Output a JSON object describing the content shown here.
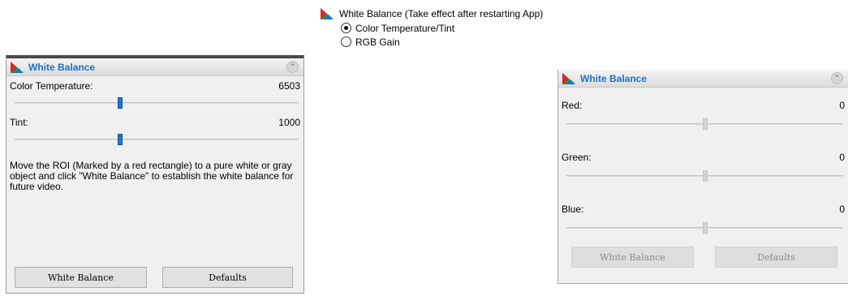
{
  "option_group": {
    "title": "White Balance (Take effect after restarting App)",
    "options": [
      {
        "label": "Color Temperature/Tint",
        "selected": true
      },
      {
        "label": "RGB Gain",
        "selected": false
      }
    ]
  },
  "left_panel": {
    "title": "White Balance",
    "temperature": {
      "label": "Color Temperature:",
      "value": "6503",
      "position": 0.37
    },
    "tint": {
      "label": "Tint:",
      "value": "1000",
      "position": 0.37
    },
    "description": "Move the ROI (Marked by a red rectangle) to a pure white or gray object and click \"White Balance\" to establish the white balance for future video.",
    "buttons": {
      "white_balance": "White Balance",
      "defaults": "Defaults"
    }
  },
  "right_panel": {
    "title": "White Balance",
    "red": {
      "label": "Red:",
      "value": "0",
      "position": 0.5
    },
    "green": {
      "label": "Green:",
      "value": "0",
      "position": 0.5
    },
    "blue": {
      "label": "Blue:",
      "value": "0",
      "position": 0.5
    },
    "buttons": {
      "white_balance": "White Balance",
      "defaults": "Defaults"
    },
    "buttons_disabled": true
  },
  "icons": {
    "white_balance": "white-balance-icon",
    "collapse": "collapse-up-icon"
  },
  "colors": {
    "title_blue": "#1a73c8",
    "slider_blue": "#1f78d1"
  }
}
